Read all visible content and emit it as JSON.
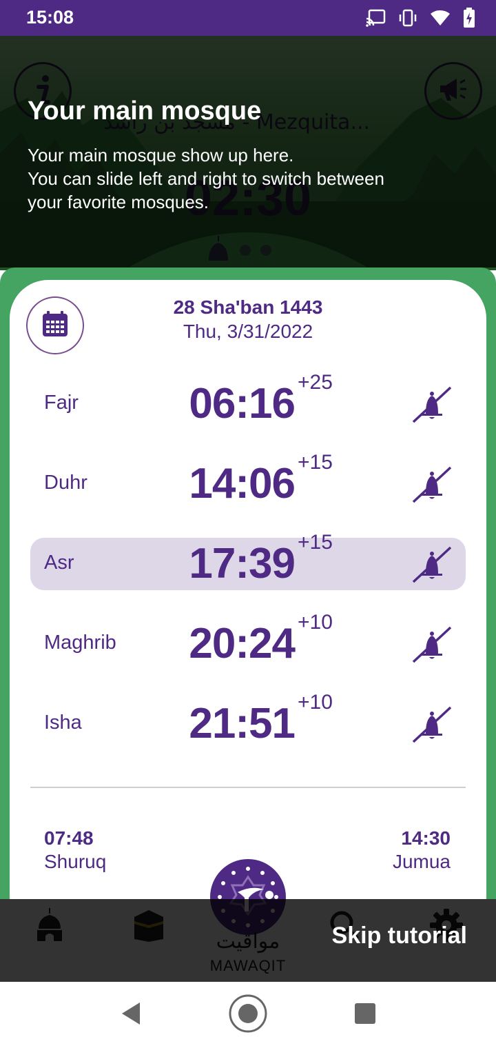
{
  "status_bar": {
    "time": "15:08",
    "icons": [
      "cast-icon",
      "vibrate-icon",
      "wifi-icon",
      "battery-charging-icon"
    ]
  },
  "header": {
    "mosque_name": "مسجد بن راشد - Mezquita...",
    "countdown": "02:30",
    "info_icon": "info-icon",
    "announce_icon": "megaphone-icon",
    "pager_dots": 3
  },
  "date": {
    "hijri": "28 Sha'ban 1443",
    "gregorian": "Thu, 3/31/2022"
  },
  "prayers": [
    {
      "name": "Fajr",
      "time": "06:16",
      "offset": "+25",
      "active": false
    },
    {
      "name": "Duhr",
      "time": "14:06",
      "offset": "+15",
      "active": false
    },
    {
      "name": "Asr",
      "time": "17:39",
      "offset": "+15",
      "active": true
    },
    {
      "name": "Maghrib",
      "time": "20:24",
      "offset": "+10",
      "active": false
    },
    {
      "name": "Isha",
      "time": "21:51",
      "offset": "+10",
      "active": false
    }
  ],
  "extra": {
    "shuruq_time": "07:48",
    "shuruq_label": "Shuruq",
    "jumua_time": "14:30",
    "jumua_label": "Jumua"
  },
  "nav": {
    "logo_ar": "مواقيت",
    "logo_en": "MAWAQIT",
    "items": [
      "mosque-icon",
      "kaaba-icon",
      "search-icon",
      "gear-icon"
    ]
  },
  "tutorial": {
    "title": "Your main mosque",
    "line1": "Your main mosque show up here.",
    "line2": "You can slide left and right to switch between",
    "line3": "your favorite mosques.",
    "skip_label": "Skip tutorial"
  },
  "colors": {
    "primary": "#4e2a84",
    "green": "#46a463",
    "active_row": "#ddd7e8"
  }
}
